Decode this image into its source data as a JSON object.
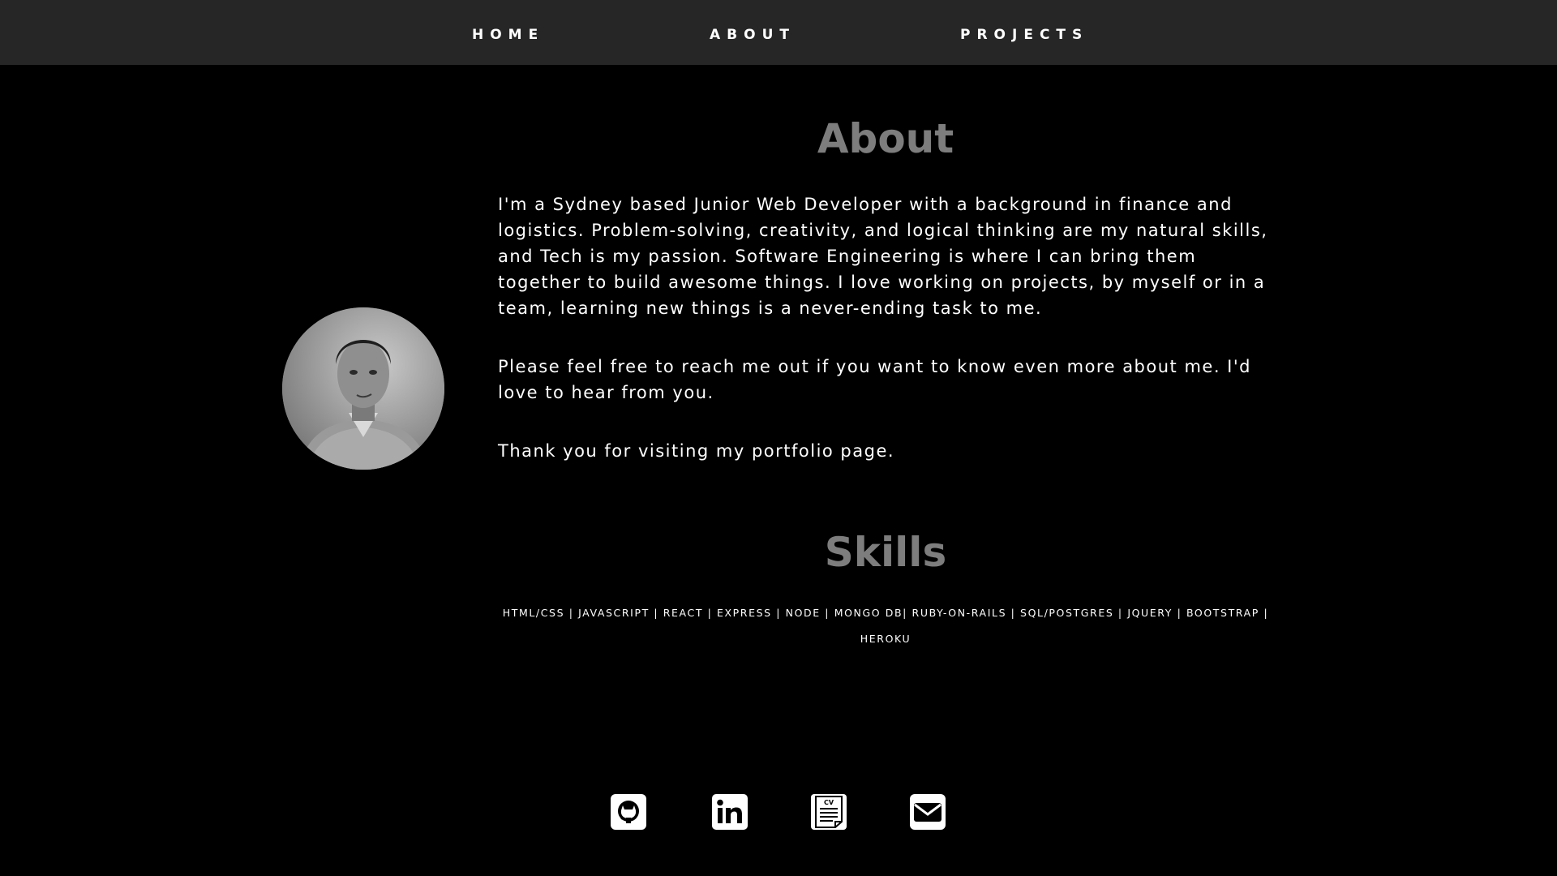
{
  "nav": {
    "home": "HOME",
    "about": "ABOUT",
    "projects": "PROJECTS"
  },
  "about": {
    "title": "About",
    "paragraphs": [
      "I'm a Sydney based Junior Web Developer with a background in finance and logistics. Problem-solving, creativity, and logical thinking are my natural skills, and Tech is my passion. Software Engineering is where I can bring them together to build awesome things. I love working on projects, by myself or in a team, learning new things is a never-ending task to me.",
      "Please feel free to reach me out if you want to know even more about me. I'd love to hear from you.",
      "Thank you for visiting my portfolio page."
    ]
  },
  "skills": {
    "title": "Skills",
    "list": "HTML/CSS | JAVASCRIPT | REACT | EXPRESS | NODE | MONGO DB| RUBY-ON-RAILS | SQL/POSTGRES | JQUERY | BOOTSTRAP | HEROKU"
  },
  "social": {
    "github_icon": "github-icon",
    "linkedin_icon": "linkedin-icon",
    "cv_icon": "cv-document-icon",
    "cv_label": "CV",
    "email_icon": "envelope-icon"
  },
  "colors": {
    "background": "#000000",
    "navbar": "#262626",
    "heading": "#7d7d7d",
    "text": "#ffffff"
  }
}
